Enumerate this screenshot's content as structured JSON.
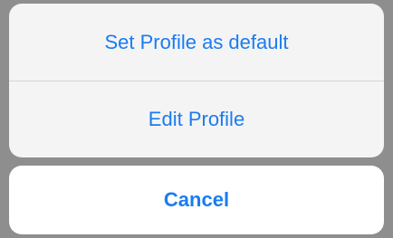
{
  "action_sheet": {
    "options": [
      {
        "label": "Set Profile as default"
      },
      {
        "label": "Edit Profile"
      }
    ],
    "cancel_label": "Cancel"
  },
  "colors": {
    "accent": "#1a7cf0",
    "sheet_background": "#f4f4f4",
    "cancel_background": "#ffffff",
    "backdrop": "#8e8e8e",
    "divider": "#d5d5d5"
  }
}
